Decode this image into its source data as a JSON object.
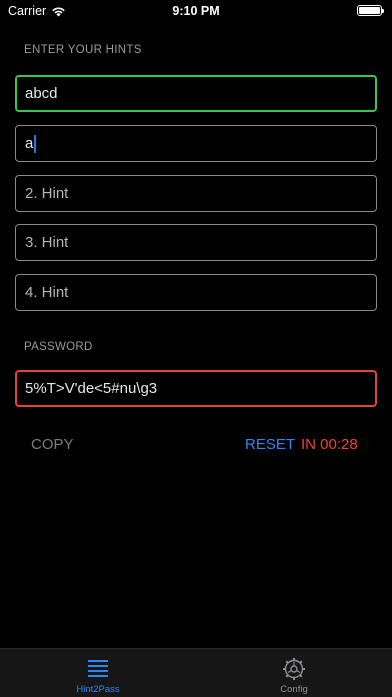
{
  "status_bar": {
    "carrier": "Carrier",
    "time": "9:10 PM"
  },
  "hints": {
    "section_label": "ENTER YOUR HINTS",
    "fields": [
      {
        "value": "abcd",
        "placeholder": ""
      },
      {
        "value": "a",
        "placeholder": ""
      },
      {
        "value": "",
        "placeholder": "2. Hint"
      },
      {
        "value": "",
        "placeholder": "3. Hint"
      },
      {
        "value": "",
        "placeholder": "4. Hint"
      }
    ]
  },
  "password": {
    "section_label": "PASSWORD",
    "value": "5%T>V'de<5#nu\\g3"
  },
  "actions": {
    "copy_label": "COPY",
    "reset_label": "RESET",
    "timer_text": "IN 00:28"
  },
  "tab_bar": {
    "tabs": [
      {
        "label": "Hint2Pass",
        "icon": "list-icon",
        "active": true
      },
      {
        "label": "Config",
        "icon": "gear-icon",
        "active": false
      }
    ]
  },
  "colors": {
    "active_field_border": "#35c84a",
    "password_border": "#e8403e",
    "reset": "#2f86f5",
    "timer": "#f0403e",
    "tab_active": "#2f86f5",
    "tab_inactive": "#8e8e93"
  }
}
